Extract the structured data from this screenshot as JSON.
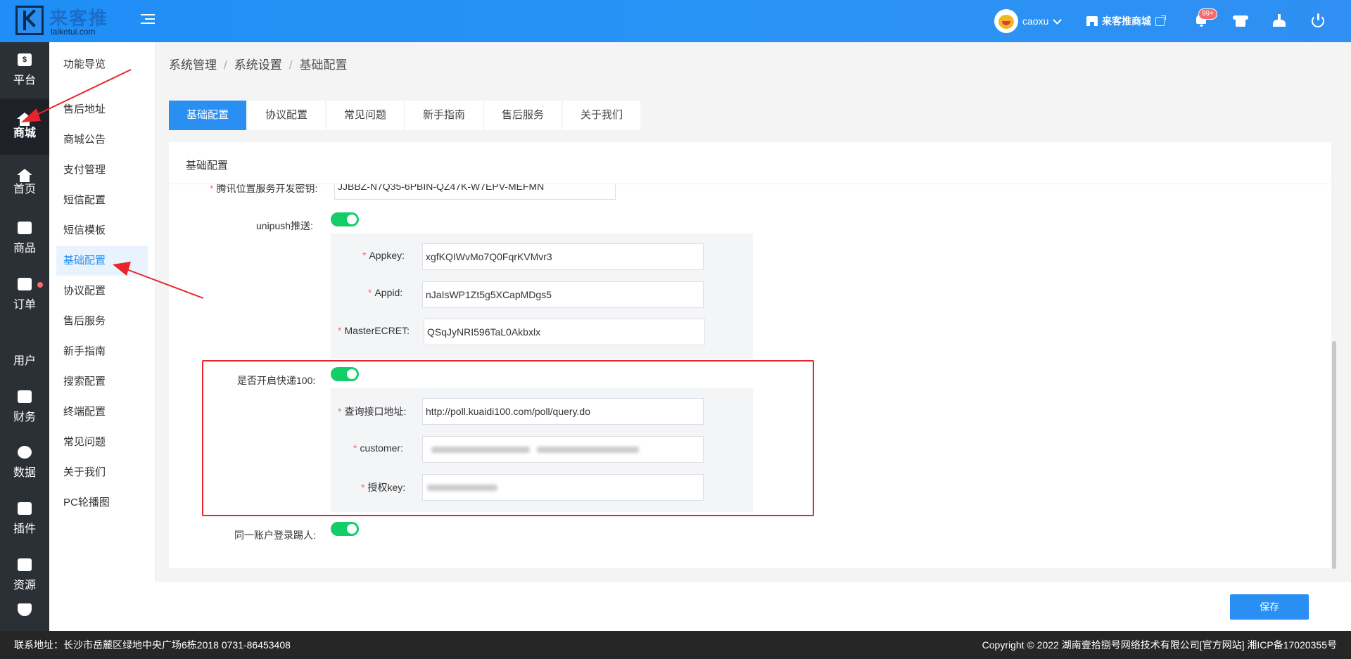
{
  "header": {
    "logo_cn": "来客推",
    "logo_en": "laiketui.com",
    "user_name": "caoxu",
    "store_label": "来客推商城",
    "notification_badge": "99+"
  },
  "rail": {
    "items": [
      {
        "label": "平台",
        "icon": "money-icon"
      },
      {
        "label": "商城",
        "icon": "home-icon"
      },
      {
        "label": "首页",
        "icon": "home-icon"
      },
      {
        "label": "商品",
        "icon": "bag-icon"
      },
      {
        "label": "订单",
        "icon": "clipboard-icon"
      },
      {
        "label": "用户",
        "icon": "user-icon"
      },
      {
        "label": "财务",
        "icon": "wallet-icon"
      },
      {
        "label": "数据",
        "icon": "pie-chart-icon"
      },
      {
        "label": "插件",
        "icon": "puzzle-icon"
      },
      {
        "label": "资源",
        "icon": "image-icon"
      }
    ],
    "platform_glyph": "$"
  },
  "submenu": {
    "items": [
      "功能导览",
      "售后地址",
      "商城公告",
      "支付管理",
      "短信配置",
      "短信模板",
      "基础配置",
      "协议配置",
      "售后服务",
      "新手指南",
      "搜索配置",
      "终端配置",
      "常见问题",
      "关于我们",
      "PC轮播图"
    ]
  },
  "breadcrumb": {
    "root": "系统管理",
    "parent": "系统设置",
    "current": "基础配置",
    "separator": "/"
  },
  "tabs": [
    "基础配置",
    "协议配置",
    "常见问题",
    "新手指南",
    "售后服务",
    "关于我们"
  ],
  "panel": {
    "title": "基础配置",
    "tencent_label": "腾讯位置服务开发密钥:",
    "tencent_value": "JJBBZ-N7Q35-6PBIN-QZ47K-W7EPV-MEFMN",
    "unipush_label": "unipush推送:",
    "appkey_label": "Appkey:",
    "appkey_value": "xgfKQIWvMo7Q0FqrKVMvr3",
    "appid_label": "Appid:",
    "appid_value": "nJaIsWP1Zt5g5XCapMDgs5",
    "master_label": "MasterECRET:",
    "master_value": "QSqJyNRI596TaL0Akbxlx",
    "kuaidi_label": "是否开启快递100:",
    "query_label": "查询接口地址:",
    "query_value": "http://poll.kuaidi100.com/poll/query.do",
    "customer_label": "customer:",
    "authkey_label": "授权key:",
    "kick_label": "同一账户登录踢人:",
    "required_mark": "*"
  },
  "actions": {
    "save": "保存"
  },
  "footer": {
    "address": "联系地址：长沙市岳麓区绿地中央广场6栋2018 0731-86453408",
    "copyright": "Copyright © 2022 湖南壹拾捌号网络技术有限公司[官方网站]  湘ICP备17020355号"
  },
  "colors": {
    "primary": "#2a8ff3",
    "toggle_on": "#13ce66",
    "highlight_box": "#e8252b",
    "rail_bg": "#2b2f36"
  }
}
